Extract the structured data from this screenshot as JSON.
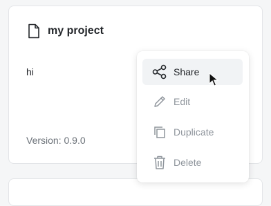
{
  "project": {
    "title": "my project",
    "description": "hi",
    "version": "Version: 0.9.0"
  },
  "menu": {
    "items": [
      {
        "label": "Share",
        "icon": "share-icon",
        "state": "hovered"
      },
      {
        "label": "Edit",
        "icon": "pencil-icon",
        "state": "disabled"
      },
      {
        "label": "Duplicate",
        "icon": "duplicate-icon",
        "state": "disabled"
      },
      {
        "label": "Delete",
        "icon": "trash-icon",
        "state": "disabled"
      }
    ]
  },
  "colors": {
    "text": "#23262a",
    "muted": "#8f959c",
    "hover_bg": "#f1f3f5"
  }
}
